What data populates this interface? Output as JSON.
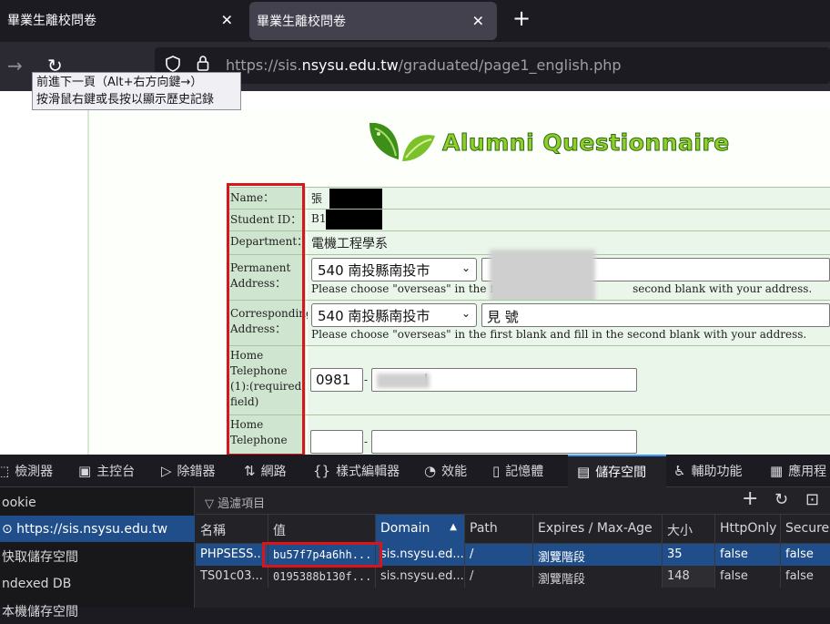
{
  "browser": {
    "tabs": [
      {
        "title": "畢業生離校問卷",
        "close": "✕"
      },
      {
        "title": "畢業生離校問卷",
        "close": "✕"
      }
    ],
    "new_tab": "+",
    "forward_icon": "→",
    "reload_icon": "↻",
    "url_prefix": "https://sis.",
    "url_domain": "nsysu.edu.tw",
    "url_path": "/graduated/page1_english.php",
    "tooltip_line1": "前進下一頁（Alt+右方向鍵→）",
    "tooltip_line2": "按滑鼠右鍵或長按以顯示歷史記錄"
  },
  "page": {
    "title": "Alumni Questionnaire",
    "form": {
      "name_label": "Name：",
      "name_value": "張",
      "student_id_label": "Student ID：",
      "student_id_value": "B1",
      "department_label": "Department：",
      "department_value": "電機工程學系",
      "permanent_label": "Permanent Address：",
      "permanent_select": "540 南投縣南投市",
      "permanent_hint": "Please choose \"overseas\" in the first",
      "permanent_hint_end": "second blank with your address.",
      "corresponding_label": "Corresponding Address：",
      "corresponding_select": "540 南投縣南投市",
      "corresponding_text": "見 號",
      "corresponding_hint": "Please choose \"overseas\" in the first blank and fill in the second blank with your address.",
      "home_tel1_label": "Home Telephone (1):(required field)",
      "home_tel1_area": "0981",
      "home_tel1_dash": "-",
      "home_tel1_number": "l",
      "home_tel2_label": "Home Telephone",
      "home_tel2_dash": "-"
    }
  },
  "devtools": {
    "tabs": [
      {
        "icon": "⬚",
        "label": "檢測器"
      },
      {
        "icon": "▣",
        "label": "主控台"
      },
      {
        "icon": "▷",
        "label": "除錯器"
      },
      {
        "icon": "⇅",
        "label": "網路"
      },
      {
        "icon": "{}",
        "label": "樣式編輯器"
      },
      {
        "icon": "◔",
        "label": "效能"
      },
      {
        "icon": "▯",
        "label": "記憶體"
      },
      {
        "icon": "▤",
        "label": "儲存空間"
      },
      {
        "icon": "♿",
        "label": "輔助功能"
      },
      {
        "icon": "▦",
        "label": "應用程"
      }
    ],
    "sidebar": [
      {
        "label": "ookie"
      },
      {
        "label": "⊙ https://sis.nsysu.edu.tw"
      },
      {
        "label": "快取儲存空間"
      },
      {
        "label": "ndexed DB"
      },
      {
        "label": "本機儲存空間"
      }
    ],
    "filter_placeholder": "▽ 過濾項目",
    "add_icon": "+",
    "refresh_icon": "↻",
    "panel_icon": "⊡",
    "columns": [
      "名稱",
      "值",
      "Domain",
      "Path",
      "Expires / Max-Age",
      "大小",
      "HttpOnly",
      "Secure"
    ],
    "sort_indicator": "▲",
    "rows": [
      [
        "PHPSESS...",
        "bu57f7p4a6hh...",
        "sis.nsysu.ed...",
        "/",
        "瀏覽階段",
        "35",
        "false",
        "false"
      ],
      [
        "TS01c03...",
        "0195388b130f...",
        "sis.nsysu.ed...",
        "/",
        "瀏覽階段",
        "148",
        "false",
        "false"
      ]
    ]
  },
  "colors": {
    "accent": "#204e8a",
    "highlight_box": "#d9141b",
    "form_label_bg": "#cfe5cf",
    "form_value_bg": "#eaf6ea"
  }
}
